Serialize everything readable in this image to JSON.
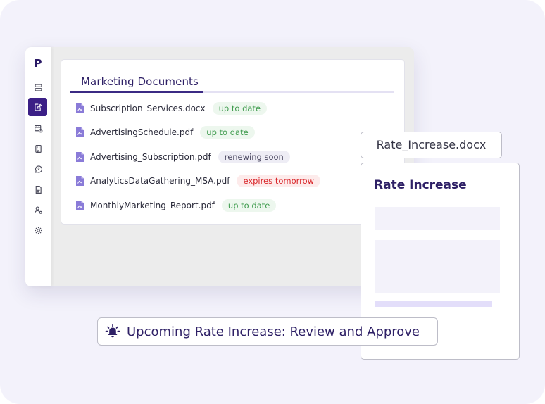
{
  "app": {
    "logo": "P"
  },
  "sidebar": {
    "items": [
      {
        "name": "storage",
        "icon": "database-icon"
      },
      {
        "name": "edit-documents",
        "icon": "edit-document-icon",
        "active": true
      },
      {
        "name": "calendar",
        "icon": "calendar-clock-icon"
      },
      {
        "name": "building",
        "icon": "building-icon"
      },
      {
        "name": "chat",
        "icon": "chat-bubble-icon"
      },
      {
        "name": "document",
        "icon": "document-icon"
      },
      {
        "name": "user-settings",
        "icon": "user-gear-icon"
      },
      {
        "name": "settings",
        "icon": "gear-icon"
      }
    ]
  },
  "documents": {
    "title": "Marketing Documents",
    "files": [
      {
        "name": "Subscription_Services.docx",
        "status": "up to date",
        "status_type": "green"
      },
      {
        "name": "AdvertisingSchedule.pdf",
        "status": "up to date",
        "status_type": "green"
      },
      {
        "name": "Advertising_Subscription.pdf",
        "status": "renewing soon",
        "status_type": "gray"
      },
      {
        "name": "AnalyticsDataGathering_MSA.pdf",
        "status": "expires tomorrow",
        "status_type": "red"
      },
      {
        "name": "MonthlyMarketing_Report.pdf",
        "status": "up to date",
        "status_type": "green"
      }
    ]
  },
  "file_chip": {
    "label": "Rate_Increase.docx"
  },
  "preview": {
    "title": "Rate Increase"
  },
  "alert": {
    "text": "Upcoming Rate Increase: Review and Approve",
    "icon": "bell-alert-icon"
  },
  "colors": {
    "brand": "#3b1f86",
    "heading": "#2e2066",
    "ok": "#3d9a4c",
    "warn": "#d9262a",
    "file_icon": "#8a7bd8"
  }
}
